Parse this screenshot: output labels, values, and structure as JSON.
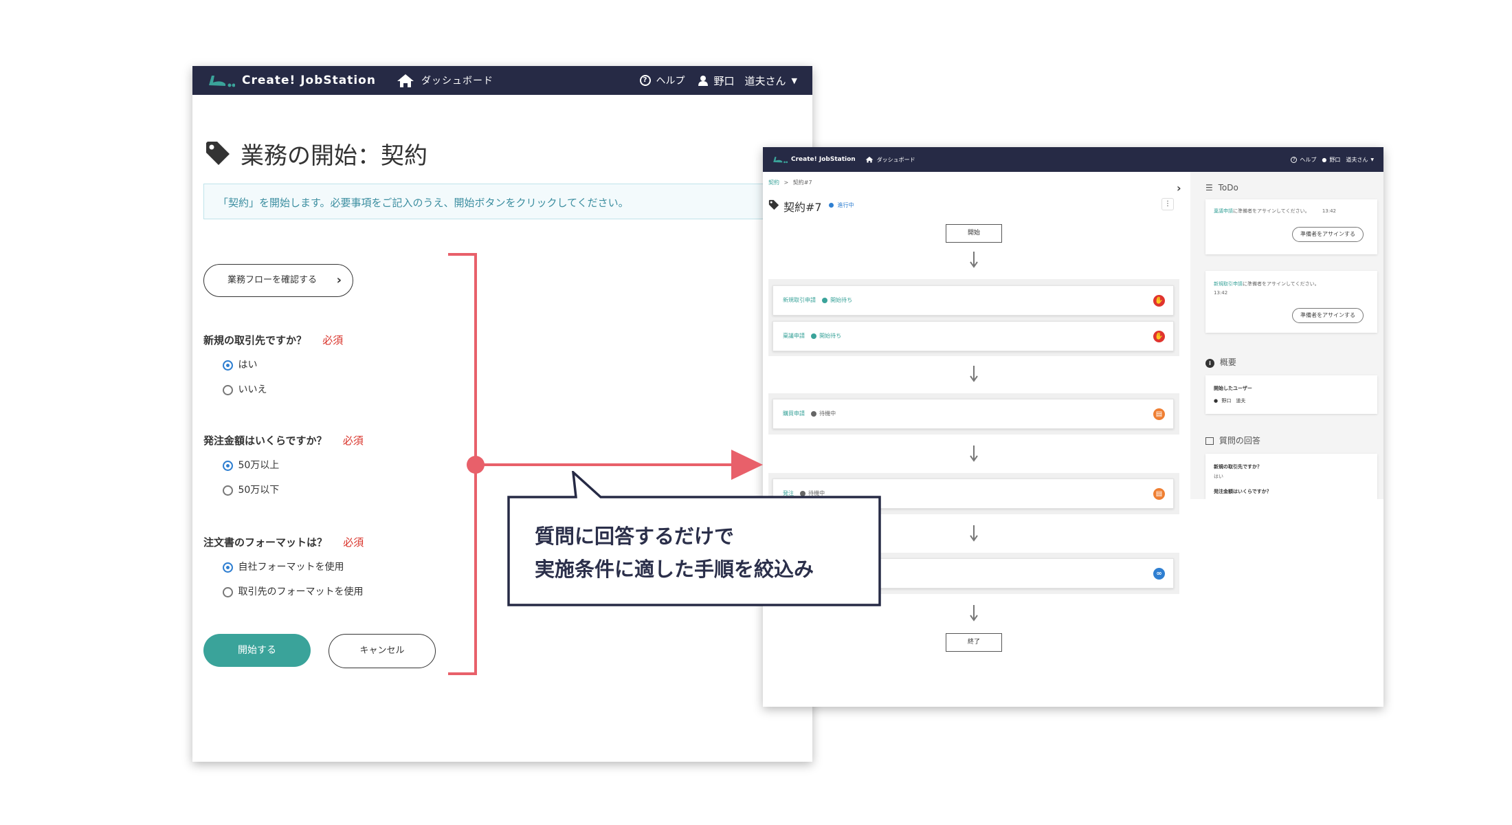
{
  "left": {
    "brand": "Create! JobStation",
    "nav_dashboard": "ダッシュボード",
    "nav_help": "ヘルプ",
    "user_name": "野口　道夫さん",
    "title": "業務の開始：契約",
    "info": "「契約」を開始します。必要事項をご記入のうえ、開始ボタンをクリックしてください。",
    "flow_button": "業務フローを確認する",
    "required_label": "必須",
    "q1": {
      "label": "新規の取引先ですか？",
      "options": [
        "はい",
        "いいえ"
      ],
      "selected": 0
    },
    "q2": {
      "label": "発注金額はいくらですか？",
      "options": [
        "50万以上",
        "50万以下"
      ],
      "selected": 0
    },
    "q3": {
      "label": "注文書のフォーマットは？",
      "options": [
        "自社フォーマットを使用",
        "取引先のフォーマットを使用"
      ],
      "selected": 0
    },
    "start_button": "開始する",
    "cancel_button": "キャンセル"
  },
  "callout": {
    "line1": "質問に回答するだけで",
    "line2": "実施条件に適した手順を絞込み"
  },
  "right": {
    "brand": "Create! JobStation",
    "nav_dashboard": "ダッシュボード",
    "nav_help": "ヘルプ",
    "user_name": "野口　道夫さん",
    "breadcrumb_root": "契約",
    "breadcrumb_sep": ">",
    "breadcrumb_current": "契約#7",
    "title": "契約#7",
    "title_status": "進行中",
    "flow_start": "開始",
    "flow_end": "終了",
    "steps": [
      {
        "name": "新規取引申請",
        "status": "開始待ち"
      },
      {
        "name": "稟議申請",
        "status": "開始待ち"
      },
      {
        "name": "購買申請",
        "status": "待機中"
      },
      {
        "name": "発注",
        "status": "待機中"
      }
    ],
    "todo_header": "ToDo",
    "todos": [
      {
        "link": "稟議申請",
        "text": "に準備者をアサインしてください。",
        "time": "13:42",
        "button": "準備者をアサインする"
      },
      {
        "link": "新規取引申請",
        "text": "に準備者をアサインしてください。",
        "time": "13:42",
        "button": "準備者をアサインする"
      }
    ],
    "summary_header": "概要",
    "summary_label": "開始したユーザー",
    "summary_user": "野口　道夫",
    "answers_header": "質問の回答",
    "answers": [
      {
        "q": "新規の取引先ですか？",
        "a": "はい"
      },
      {
        "q": "発注金額はいくらですか？",
        "a": ""
      }
    ]
  },
  "colors": {
    "navbar": "#262a45",
    "teal": "#3aa39a",
    "required": "#d9342b",
    "bracket": "#e8606a",
    "status_red": "#e0342e",
    "status_orange": "#ef7f33",
    "status_blue": "#2f7fd1"
  }
}
